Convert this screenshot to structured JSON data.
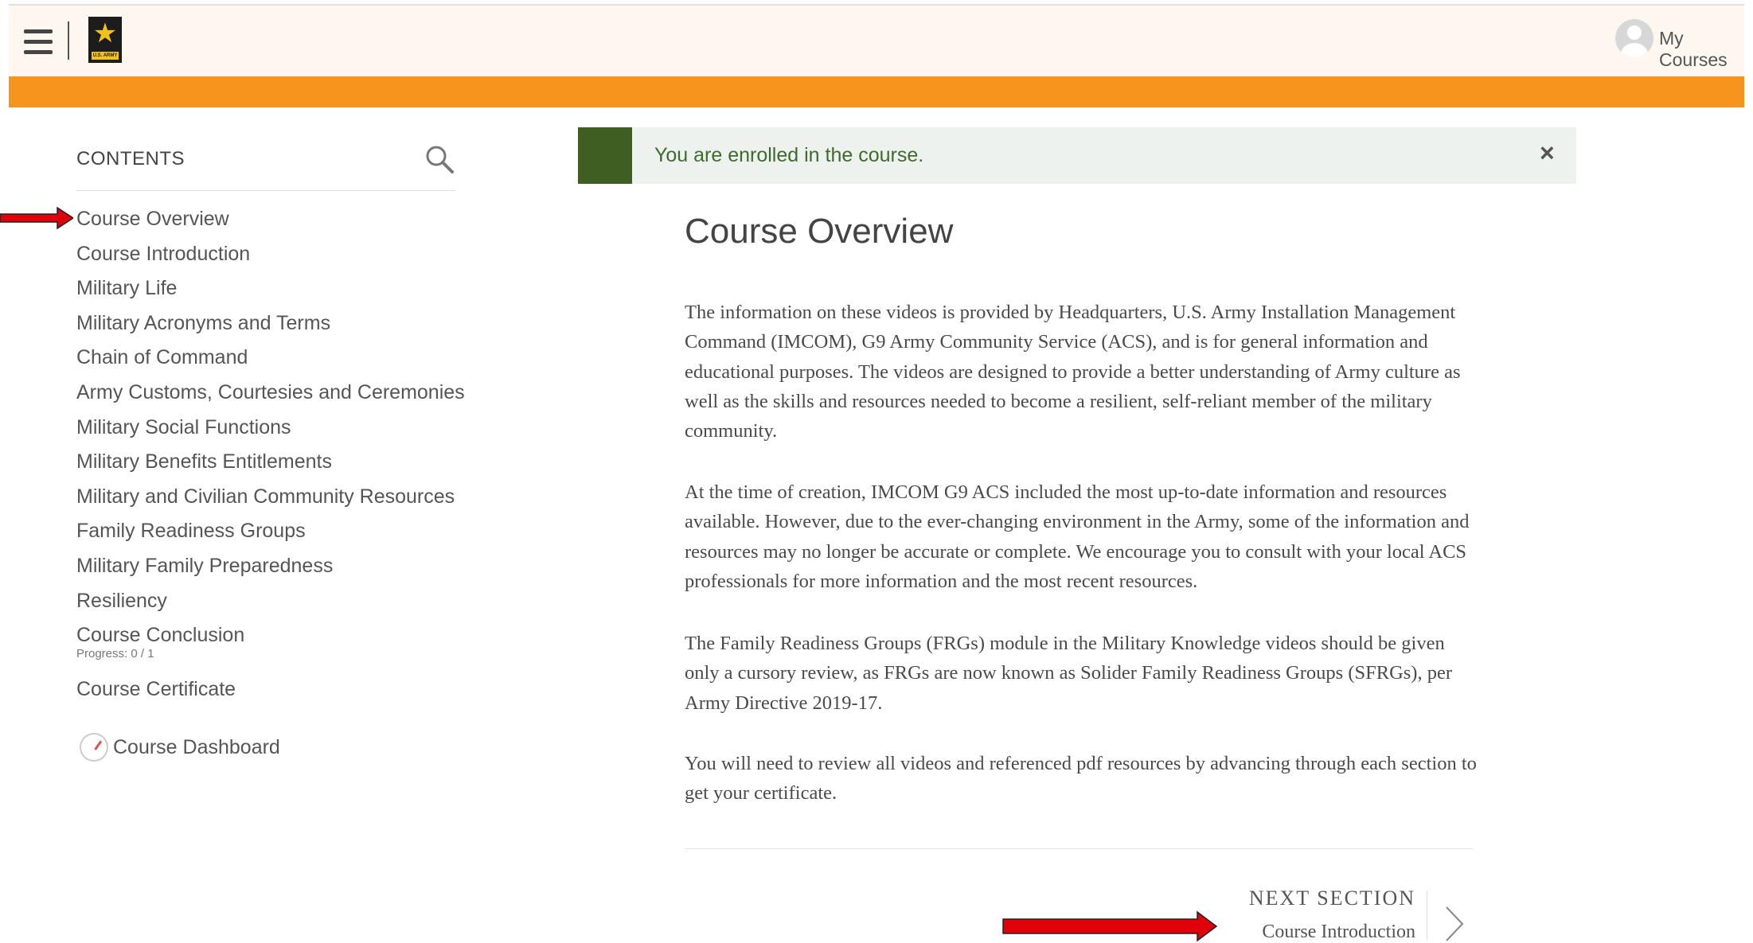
{
  "header": {
    "logo_text": "U.S. ARMY",
    "my_courses_label": "My Courses"
  },
  "sidebar": {
    "title": "CONTENTS",
    "items": [
      {
        "label": "Course Overview"
      },
      {
        "label": "Course Introduction"
      },
      {
        "label": "Military Life"
      },
      {
        "label": "Military Acronyms and Terms"
      },
      {
        "label": "Chain of Command"
      },
      {
        "label": "Army Customs, Courtesies and Ceremonies"
      },
      {
        "label": "Military Social Functions"
      },
      {
        "label": "Military Benefits Entitlements"
      },
      {
        "label": "Military and Civilian Community Resources"
      },
      {
        "label": "Family Readiness Groups"
      },
      {
        "label": "Military Family Preparedness"
      },
      {
        "label": "Resiliency"
      },
      {
        "label": "Course Conclusion",
        "progress": "Progress: 0 / 1"
      },
      {
        "label": "Course Certificate"
      }
    ],
    "dashboard_label": "Course Dashboard"
  },
  "alert": {
    "message": "You are enrolled in the course.",
    "close_symbol": "×"
  },
  "main": {
    "title": "Course Overview",
    "paragraphs": [
      "The information on these videos is provided by Headquarters, U.S. Army Installation Management Command (IMCOM), G9 Army Community Service (ACS), and is for general information and educational purposes.  The videos are designed to provide a better understanding of Army culture as well as the skills and resources needed to become a resilient, self-reliant member of the military community.",
      "At the time of creation, IMCOM G9 ACS included the most up-to-date information and resources available. However, due to the ever-changing environment in the Army, some of the information and resources may no longer be accurate or complete. We encourage you to consult with your local ACS professionals for more information and the most recent resources.",
      "The Family Readiness Groups (FRGs) module in the Military Knowledge videos should be given only a cursory review, as FRGs are now known as Solider Family Readiness Groups (SFRGs), per Army Directive 2019-17.",
      "You will need to review all videos and referenced pdf resources by advancing through each section to get your certificate."
    ],
    "next_section_label": "NEXT SECTION",
    "next_section_title": "Course Introduction"
  },
  "colors": {
    "accent_orange": "#f7941d",
    "alert_green": "#3e5e22",
    "annotation_arrow": "#e0000a"
  },
  "icons": [
    "hamburger-icon",
    "army-logo",
    "avatar",
    "search-icon",
    "dashboard-icon",
    "chevron-right-icon"
  ]
}
